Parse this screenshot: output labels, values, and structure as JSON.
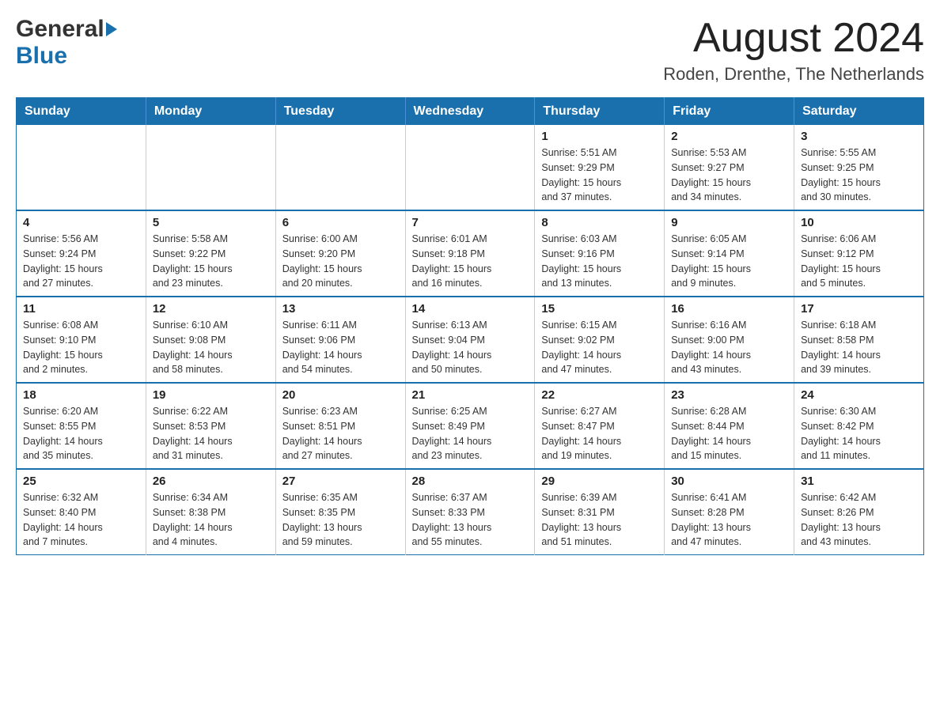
{
  "header": {
    "logo_general": "General",
    "logo_blue": "Blue",
    "month_title": "August 2024",
    "location": "Roden, Drenthe, The Netherlands"
  },
  "days_of_week": [
    "Sunday",
    "Monday",
    "Tuesday",
    "Wednesday",
    "Thursday",
    "Friday",
    "Saturday"
  ],
  "weeks": [
    [
      {
        "day": "",
        "info": ""
      },
      {
        "day": "",
        "info": ""
      },
      {
        "day": "",
        "info": ""
      },
      {
        "day": "",
        "info": ""
      },
      {
        "day": "1",
        "info": "Sunrise: 5:51 AM\nSunset: 9:29 PM\nDaylight: 15 hours\nand 37 minutes."
      },
      {
        "day": "2",
        "info": "Sunrise: 5:53 AM\nSunset: 9:27 PM\nDaylight: 15 hours\nand 34 minutes."
      },
      {
        "day": "3",
        "info": "Sunrise: 5:55 AM\nSunset: 9:25 PM\nDaylight: 15 hours\nand 30 minutes."
      }
    ],
    [
      {
        "day": "4",
        "info": "Sunrise: 5:56 AM\nSunset: 9:24 PM\nDaylight: 15 hours\nand 27 minutes."
      },
      {
        "day": "5",
        "info": "Sunrise: 5:58 AM\nSunset: 9:22 PM\nDaylight: 15 hours\nand 23 minutes."
      },
      {
        "day": "6",
        "info": "Sunrise: 6:00 AM\nSunset: 9:20 PM\nDaylight: 15 hours\nand 20 minutes."
      },
      {
        "day": "7",
        "info": "Sunrise: 6:01 AM\nSunset: 9:18 PM\nDaylight: 15 hours\nand 16 minutes."
      },
      {
        "day": "8",
        "info": "Sunrise: 6:03 AM\nSunset: 9:16 PM\nDaylight: 15 hours\nand 13 minutes."
      },
      {
        "day": "9",
        "info": "Sunrise: 6:05 AM\nSunset: 9:14 PM\nDaylight: 15 hours\nand 9 minutes."
      },
      {
        "day": "10",
        "info": "Sunrise: 6:06 AM\nSunset: 9:12 PM\nDaylight: 15 hours\nand 5 minutes."
      }
    ],
    [
      {
        "day": "11",
        "info": "Sunrise: 6:08 AM\nSunset: 9:10 PM\nDaylight: 15 hours\nand 2 minutes."
      },
      {
        "day": "12",
        "info": "Sunrise: 6:10 AM\nSunset: 9:08 PM\nDaylight: 14 hours\nand 58 minutes."
      },
      {
        "day": "13",
        "info": "Sunrise: 6:11 AM\nSunset: 9:06 PM\nDaylight: 14 hours\nand 54 minutes."
      },
      {
        "day": "14",
        "info": "Sunrise: 6:13 AM\nSunset: 9:04 PM\nDaylight: 14 hours\nand 50 minutes."
      },
      {
        "day": "15",
        "info": "Sunrise: 6:15 AM\nSunset: 9:02 PM\nDaylight: 14 hours\nand 47 minutes."
      },
      {
        "day": "16",
        "info": "Sunrise: 6:16 AM\nSunset: 9:00 PM\nDaylight: 14 hours\nand 43 minutes."
      },
      {
        "day": "17",
        "info": "Sunrise: 6:18 AM\nSunset: 8:58 PM\nDaylight: 14 hours\nand 39 minutes."
      }
    ],
    [
      {
        "day": "18",
        "info": "Sunrise: 6:20 AM\nSunset: 8:55 PM\nDaylight: 14 hours\nand 35 minutes."
      },
      {
        "day": "19",
        "info": "Sunrise: 6:22 AM\nSunset: 8:53 PM\nDaylight: 14 hours\nand 31 minutes."
      },
      {
        "day": "20",
        "info": "Sunrise: 6:23 AM\nSunset: 8:51 PM\nDaylight: 14 hours\nand 27 minutes."
      },
      {
        "day": "21",
        "info": "Sunrise: 6:25 AM\nSunset: 8:49 PM\nDaylight: 14 hours\nand 23 minutes."
      },
      {
        "day": "22",
        "info": "Sunrise: 6:27 AM\nSunset: 8:47 PM\nDaylight: 14 hours\nand 19 minutes."
      },
      {
        "day": "23",
        "info": "Sunrise: 6:28 AM\nSunset: 8:44 PM\nDaylight: 14 hours\nand 15 minutes."
      },
      {
        "day": "24",
        "info": "Sunrise: 6:30 AM\nSunset: 8:42 PM\nDaylight: 14 hours\nand 11 minutes."
      }
    ],
    [
      {
        "day": "25",
        "info": "Sunrise: 6:32 AM\nSunset: 8:40 PM\nDaylight: 14 hours\nand 7 minutes."
      },
      {
        "day": "26",
        "info": "Sunrise: 6:34 AM\nSunset: 8:38 PM\nDaylight: 14 hours\nand 4 minutes."
      },
      {
        "day": "27",
        "info": "Sunrise: 6:35 AM\nSunset: 8:35 PM\nDaylight: 13 hours\nand 59 minutes."
      },
      {
        "day": "28",
        "info": "Sunrise: 6:37 AM\nSunset: 8:33 PM\nDaylight: 13 hours\nand 55 minutes."
      },
      {
        "day": "29",
        "info": "Sunrise: 6:39 AM\nSunset: 8:31 PM\nDaylight: 13 hours\nand 51 minutes."
      },
      {
        "day": "30",
        "info": "Sunrise: 6:41 AM\nSunset: 8:28 PM\nDaylight: 13 hours\nand 47 minutes."
      },
      {
        "day": "31",
        "info": "Sunrise: 6:42 AM\nSunset: 8:26 PM\nDaylight: 13 hours\nand 43 minutes."
      }
    ]
  ]
}
